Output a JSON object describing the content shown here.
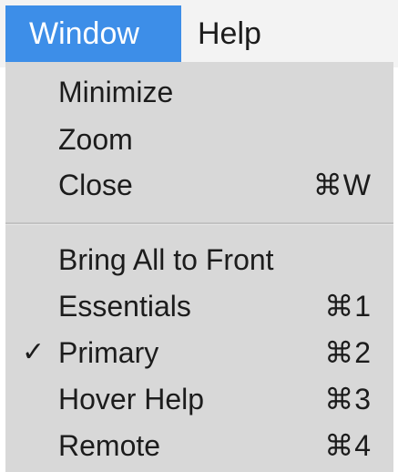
{
  "menubar": {
    "window_label": "Window",
    "help_label": "Help"
  },
  "menu": {
    "group1": [
      {
        "label": "Minimize",
        "shortcut": ""
      },
      {
        "label": "Zoom",
        "shortcut": ""
      },
      {
        "label": "Close",
        "shortcut": "⌘W"
      }
    ],
    "group2": [
      {
        "label": "Bring All to Front",
        "shortcut": "",
        "checked": false
      },
      {
        "label": "Essentials",
        "shortcut": "⌘1",
        "checked": false
      },
      {
        "label": "Primary",
        "shortcut": "⌘2",
        "checked": true
      },
      {
        "label": "Hover Help",
        "shortcut": "⌘3",
        "checked": false
      },
      {
        "label": "Remote",
        "shortcut": "⌘4",
        "checked": false
      }
    ],
    "checkmark": "✓"
  },
  "colors": {
    "highlight": "#3d8ee8",
    "menu_background": "#d8d8d8",
    "menubar_background": "#f3f3f3"
  }
}
